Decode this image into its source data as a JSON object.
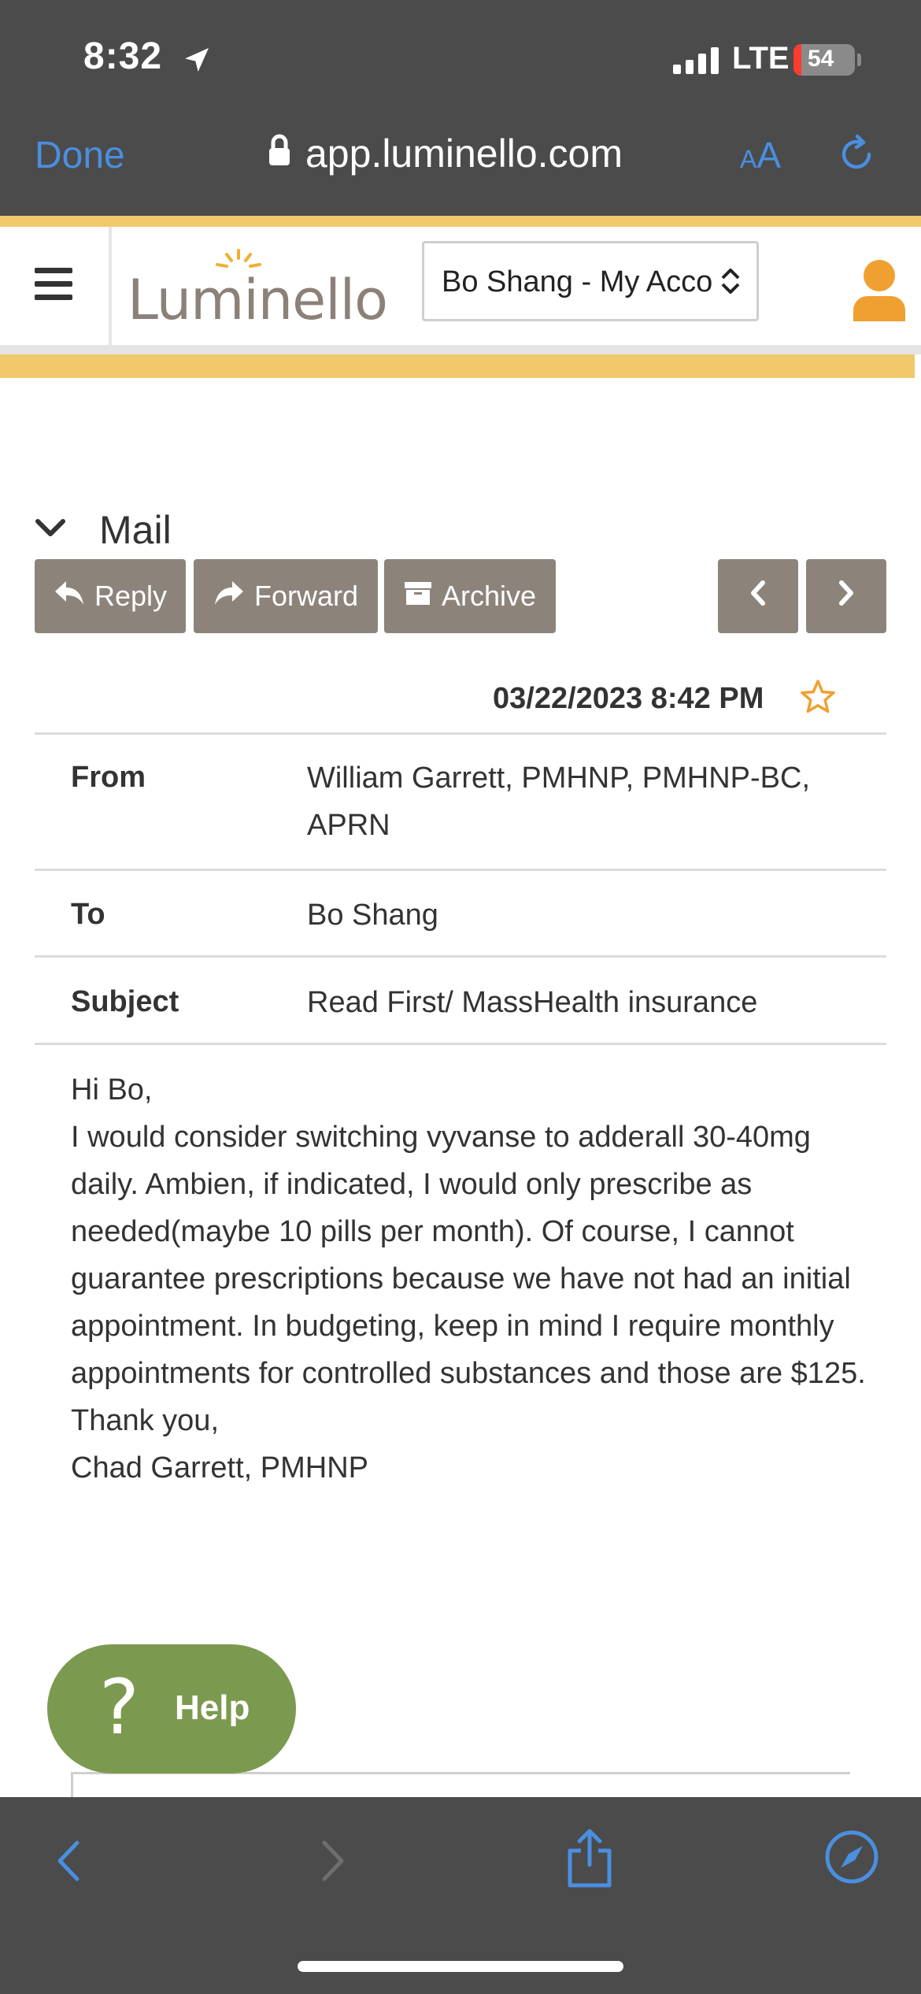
{
  "status_bar": {
    "time": "8:32",
    "network": "LTE",
    "battery": "54",
    "icons": [
      "location-arrow-icon",
      "signal-icon",
      "battery-icon"
    ]
  },
  "browser": {
    "done_label": "Done",
    "url": "app.luminello.com",
    "text_size_label_small": "A",
    "text_size_label_large": "A",
    "icons": [
      "lock-icon",
      "reload-icon",
      "back-icon",
      "forward-icon",
      "share-icon",
      "compass-icon"
    ],
    "accent_color": "#4a8fe0"
  },
  "app_header": {
    "logo_text": "Luminello",
    "account_selector_value": "Bo Shang - My Acco",
    "icons": [
      "menu-icon",
      "logo-sun-icon",
      "select-chevron-icon",
      "user-avatar-icon"
    ],
    "brand_color": "#f0c96b",
    "avatar_color": "#f0a030"
  },
  "mail": {
    "section_title": "Mail",
    "toolbar": {
      "reply_label": "Reply",
      "forward_label": "Forward",
      "archive_label": "Archive",
      "icons": [
        "reply-icon",
        "forward-arrow-icon",
        "archive-box-icon",
        "prev-icon",
        "next-icon"
      ],
      "button_color": "#8c847b"
    },
    "message": {
      "date": "03/22/2023 8:42 PM",
      "starred": false,
      "from_label": "From",
      "from_value": "William Garrett, PMHNP, PMHNP-BC, APRN",
      "to_label": "To",
      "to_value": "Bo Shang",
      "subject_label": "Subject",
      "subject_value": "Read First/ MassHealth insurance",
      "body": {
        "greeting": "Hi Bo,",
        "paragraph": "I would consider switching vyvanse to adderall 30-40mg daily. Ambien, if indicated, I would only prescribe as needed(maybe 10 pills per month). Of course, I cannot guarantee prescriptions because we have not had an initial appointment.  In budgeting, keep in mind I require monthly appointments for controlled substances and those are $125.",
        "closing": "Thank you,",
        "signature": "Chad Garrett, PMHNP"
      }
    }
  },
  "help": {
    "label": "Help",
    "icon": "question-mark-icon",
    "color": "#7c9a4f"
  }
}
